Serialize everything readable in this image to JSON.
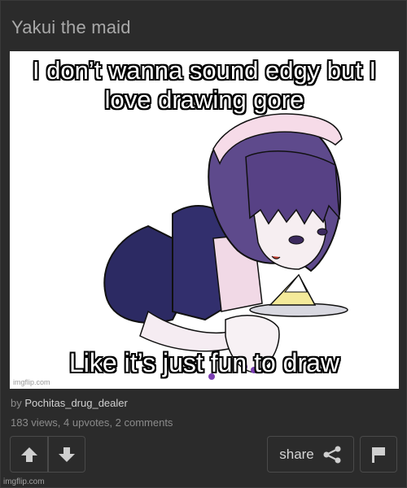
{
  "post": {
    "title": "Yakui the maid",
    "byline_prefix": "by",
    "author": "Pochitas_drug_dealer",
    "stats": "183 views, 4 upvotes, 2 comments"
  },
  "meme": {
    "top_caption": "I don’t wanna sound edgy but I love drawing gore",
    "bottom_caption": "Like it’s just fun to draw",
    "watermark": "imgflip.com"
  },
  "actions": {
    "upvote_icon": "arrow-up-icon",
    "downvote_icon": "arrow-down-icon",
    "share_label": "share",
    "share_icon": "share-icon",
    "flag_icon": "flag-icon"
  },
  "footer": {
    "watermark": "imgflip.com"
  },
  "colors": {
    "background": "#2b2b2b",
    "hair": "#5e4a8c",
    "uniform": "#2c2a63",
    "apron": "#f1d9e6"
  }
}
